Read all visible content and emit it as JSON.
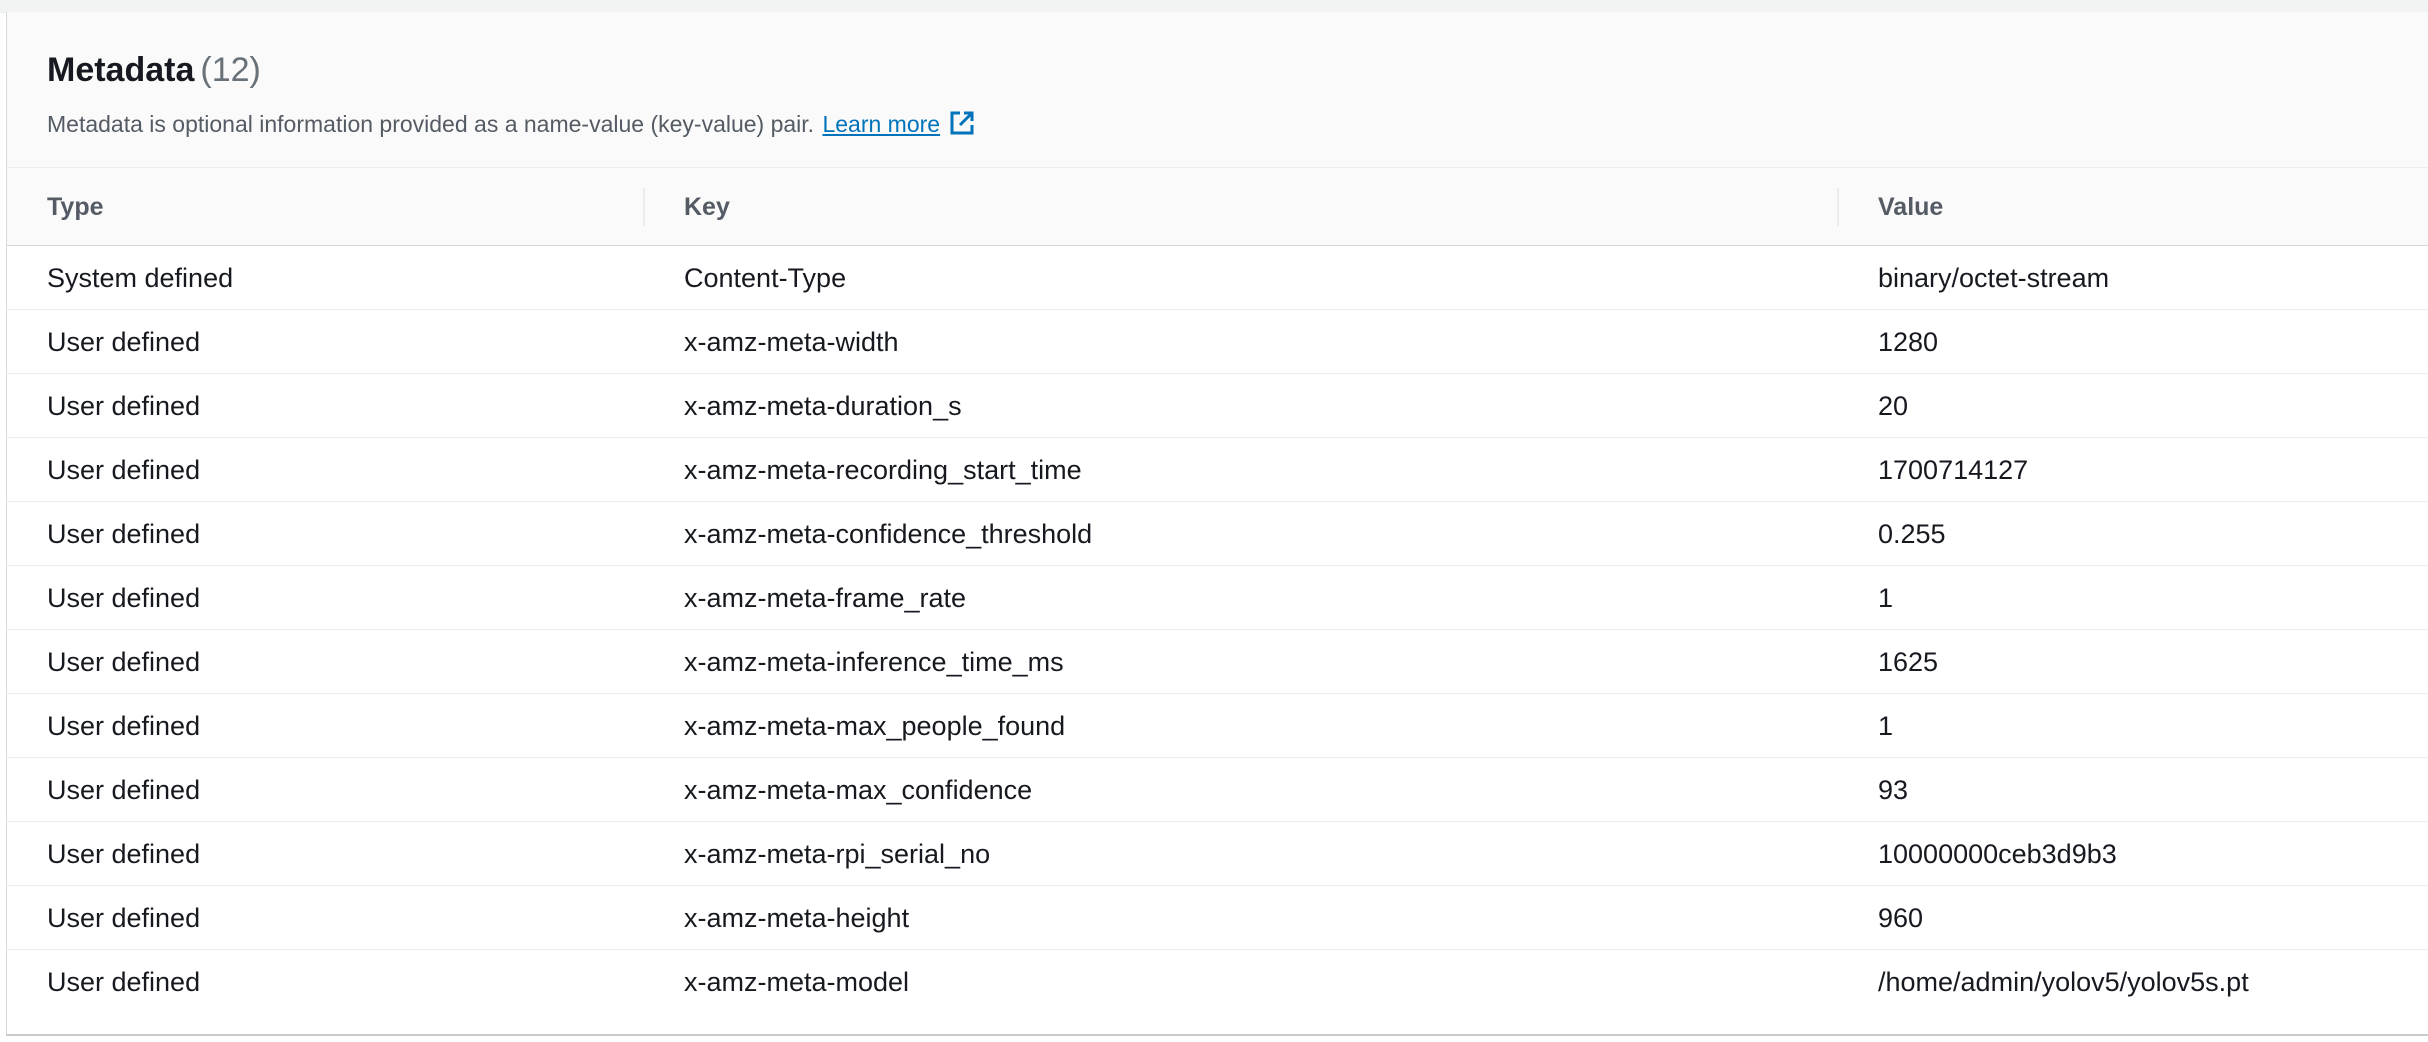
{
  "header": {
    "title": "Metadata",
    "count": "(12)",
    "description": "Metadata is optional information provided as a name-value (key-value) pair.",
    "learn_more": "Learn more",
    "learn_more_icon": "external-link-icon",
    "accent_color": "#0073bb"
  },
  "table": {
    "columns": {
      "type": "Type",
      "key": "Key",
      "value": "Value"
    },
    "rows": [
      {
        "type": "System defined",
        "key": "Content-Type",
        "value": "binary/octet-stream"
      },
      {
        "type": "User defined",
        "key": "x-amz-meta-width",
        "value": "1280"
      },
      {
        "type": "User defined",
        "key": "x-amz-meta-duration_s",
        "value": "20"
      },
      {
        "type": "User defined",
        "key": "x-amz-meta-recording_start_time",
        "value": "1700714127"
      },
      {
        "type": "User defined",
        "key": "x-amz-meta-confidence_threshold",
        "value": "0.255"
      },
      {
        "type": "User defined",
        "key": "x-amz-meta-frame_rate",
        "value": "1"
      },
      {
        "type": "User defined",
        "key": "x-amz-meta-inference_time_ms",
        "value": "1625"
      },
      {
        "type": "User defined",
        "key": "x-amz-meta-max_people_found",
        "value": "1"
      },
      {
        "type": "User defined",
        "key": "x-amz-meta-max_confidence",
        "value": "93"
      },
      {
        "type": "User defined",
        "key": "x-amz-meta-rpi_serial_no",
        "value": "10000000ceb3d9b3"
      },
      {
        "type": "User defined",
        "key": "x-amz-meta-height",
        "value": "960"
      },
      {
        "type": "User defined",
        "key": "x-amz-meta-model",
        "value": "/home/admin/yolov5/yolov5s.pt"
      }
    ]
  }
}
